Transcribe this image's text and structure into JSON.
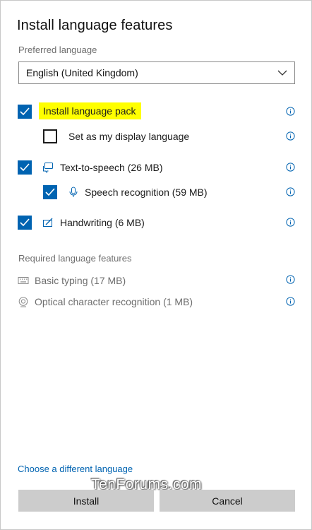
{
  "dialog": {
    "title": "Install language features",
    "preferred_language_label": "Preferred language",
    "preferred_language_value": "English (United Kingdom)"
  },
  "features": [
    {
      "label": "Install language pack",
      "checked": true,
      "icon": "none",
      "highlighted": true
    },
    {
      "label": "Set as my display language",
      "checked": false,
      "icon": "none"
    },
    {
      "label": "Text-to-speech (26 MB)",
      "checked": true,
      "icon": "speech-bubble-icon"
    },
    {
      "label": "Speech recognition (59 MB)",
      "checked": true,
      "icon": "microphone-icon"
    },
    {
      "label": "Handwriting (6 MB)",
      "checked": true,
      "icon": "pen-icon"
    }
  ],
  "required": {
    "label": "Required language features",
    "items": [
      {
        "label": "Basic typing (17 MB)",
        "icon": "keyboard-icon"
      },
      {
        "label": "Optical character recognition (1 MB)",
        "icon": "camera-icon"
      }
    ]
  },
  "footer": {
    "choose_link": "Choose a different language",
    "watermark": "TenForums.com",
    "install_button": "Install",
    "cancel_button": "Cancel"
  },
  "colors": {
    "accent": "#0063b1",
    "highlight": "#ffff00",
    "button_bg": "#cccccc"
  }
}
